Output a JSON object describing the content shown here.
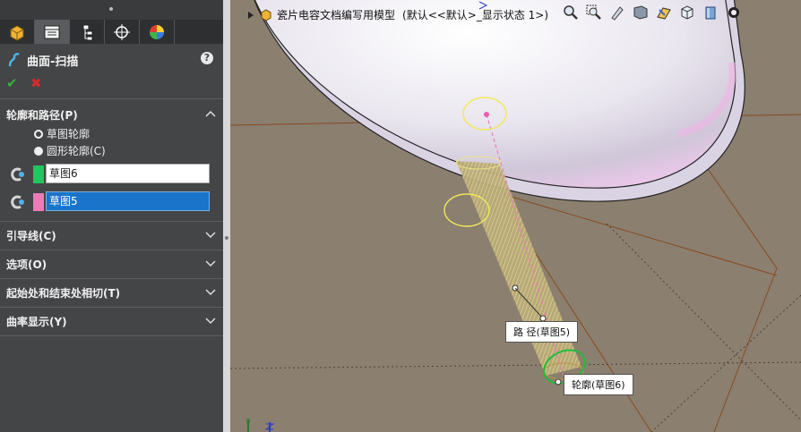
{
  "document": {
    "title": "瓷片电容文档编写用模型",
    "config": "(默认<<默认>_显示状态 1>)"
  },
  "feature": {
    "name": "曲面-扫描",
    "help_label": "?",
    "ok_label": "✔",
    "cancel_label": "✖"
  },
  "sections": {
    "profile_path": {
      "label": "轮廓和路径(P)",
      "options": [
        {
          "label": "草图轮廓",
          "selected": true
        },
        {
          "label": "圆形轮廓(C)",
          "selected": false
        }
      ],
      "profile_value": "草图6",
      "path_value": "草图5",
      "profile_color": "#22c55e",
      "path_color": "#f07ab8"
    },
    "guides": {
      "label": "引导线(C)"
    },
    "options": {
      "label": "选项(O)"
    },
    "tangency": {
      "label": "起始处和结束处相切(T)"
    },
    "curvature": {
      "label": "曲率显示(Y)"
    }
  },
  "callouts": {
    "path": "路 径(草图5)",
    "profile": "轮廓(草图6)"
  },
  "icons": {
    "tabs": [
      "feature-manager-icon",
      "property-manager-icon",
      "configuration-manager-icon",
      "dimxpert-icon",
      "display-manager-icon"
    ],
    "heads_up": [
      "zoom-to-fit-icon",
      "zoom-area-icon",
      "previous-view-icon",
      "section-view-icon",
      "view-orientation-icon",
      "display-style-icon",
      "hide-show-items-icon",
      "appearance-icon"
    ]
  },
  "colors": {
    "panel_bg": "#444547",
    "selection_blue": "#1a74c9",
    "ok_green": "#35b23a",
    "cancel_red": "#d32b2b"
  }
}
